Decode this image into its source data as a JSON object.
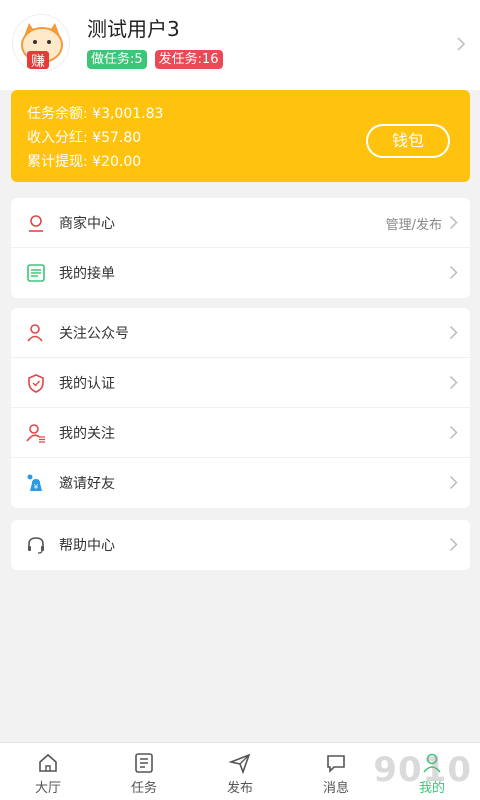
{
  "profile": {
    "username": "测试用户3",
    "avatar_text": "赚",
    "badge_do_tasks": "做任务:5",
    "badge_post_tasks": "发任务:16"
  },
  "wallet": {
    "lines": [
      "任务余额: ¥3,001.83",
      "收入分红: ¥57.80",
      "累计提现: ¥20.00"
    ],
    "button_label": "钱包"
  },
  "menu_group1": [
    {
      "label": "商家中心",
      "right": "管理/发布",
      "icon": "merchant-icon"
    },
    {
      "label": "我的接单",
      "right": "",
      "icon": "orders-icon"
    }
  ],
  "menu_group2": [
    {
      "label": "关注公众号",
      "icon": "follow-account-icon"
    },
    {
      "label": "我的认证",
      "icon": "verification-shield-icon"
    },
    {
      "label": "我的关注",
      "icon": "following-list-icon"
    },
    {
      "label": "邀请好友",
      "icon": "invite-friends-icon"
    }
  ],
  "menu_group3": [
    {
      "label": "帮助中心",
      "icon": "headset-icon"
    }
  ],
  "tabbar": [
    {
      "label": "大厅",
      "icon": "home-icon"
    },
    {
      "label": "任务",
      "icon": "task-list-icon"
    },
    {
      "label": "发布",
      "icon": "send-icon"
    },
    {
      "label": "消息",
      "icon": "message-icon"
    },
    {
      "label": "我的",
      "icon": "user-icon",
      "active": true
    }
  ],
  "watermark": "9010",
  "colors": {
    "wallet": "#ffc20e",
    "accent_green": "#3ec678",
    "accent_red": "#ea4a55"
  }
}
